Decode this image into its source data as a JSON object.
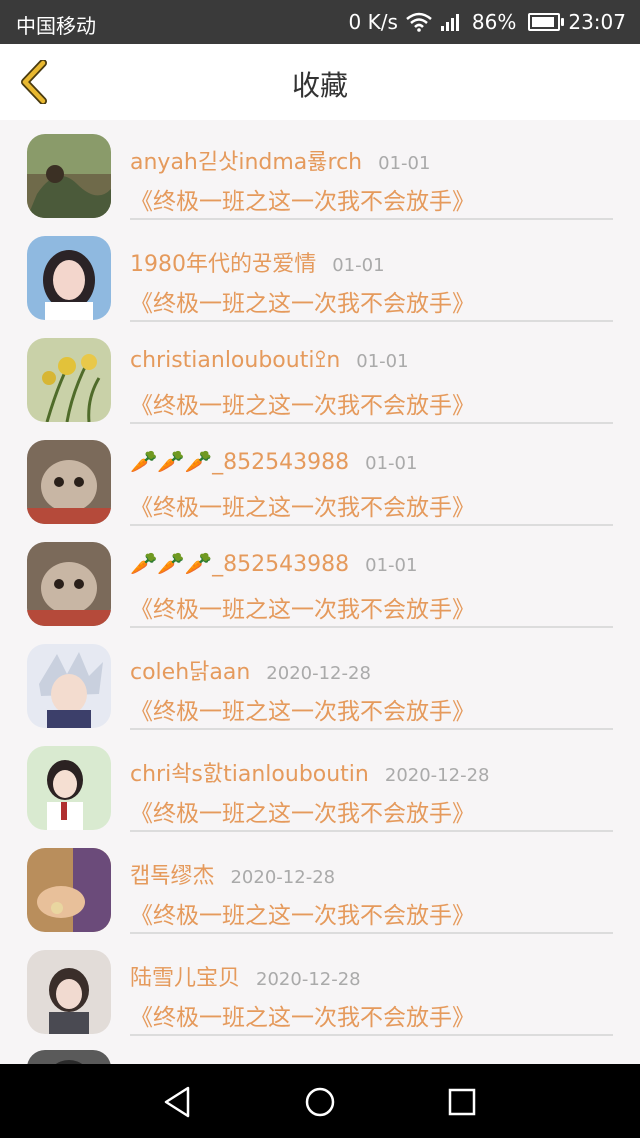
{
  "status_bar": {
    "carrier": "中国移动",
    "speed": "0 K/s",
    "battery": "86%",
    "time": "23:07"
  },
  "header": {
    "title": "收藏"
  },
  "favorites": [
    {
      "name": "anyah긷삿indma룛rch",
      "date": "01-01",
      "book": "《终极一班之这一次我不会放手》"
    },
    {
      "name": "1980年代的꿍爱情",
      "date": "01-01",
      "book": "《终极一班之这一次我不会放手》"
    },
    {
      "name": "christianlouboutiꔌn",
      "date": "01-01",
      "book": "《终极一班之这一次我不会放手》"
    },
    {
      "name": "🥕🥕🥕_852543988",
      "date": "01-01",
      "book": "《终极一班之这一次我不会放手》"
    },
    {
      "name": "🥕🥕🥕_852543988",
      "date": "01-01",
      "book": "《终极一班之这一次我不会放手》"
    },
    {
      "name": "coleh닭aan",
      "date": "2020-12-28",
      "book": "《终极一班之这一次我不会放手》"
    },
    {
      "name": "chri솩s핤tianlouboutin",
      "date": "2020-12-28",
      "book": "《终极一班之这一次我不会放手》"
    },
    {
      "name": "캡톡缪杰",
      "date": "2020-12-28",
      "book": "《终极一班之这一次我不会放手》"
    },
    {
      "name": "陆雪儿宝贝",
      "date": "2020-12-28",
      "book": "《终极一班之这一次我不会放手》"
    }
  ],
  "colors": {
    "accent": "#e59a5c",
    "back_icon": "#e8b830",
    "date": "#aaaaaa"
  },
  "icons": {
    "back": "chevron-left-icon",
    "wifi": "wifi-icon",
    "signal": "signal-icon",
    "battery": "battery-icon",
    "nav_back": "triangle-back-icon",
    "nav_home": "circle-home-icon",
    "nav_recents": "square-recents-icon"
  }
}
